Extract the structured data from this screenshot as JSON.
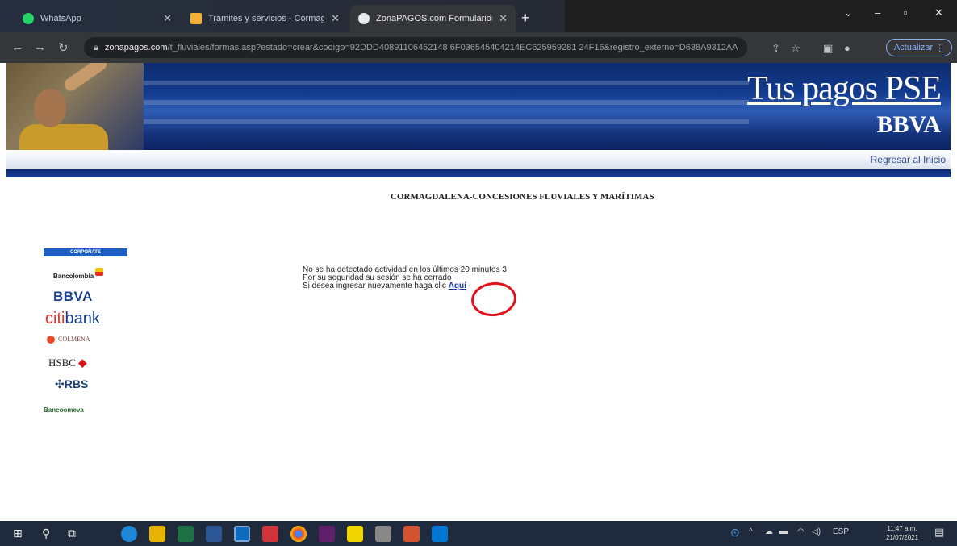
{
  "browser": {
    "tabs": [
      {
        "title": "WhatsApp",
        "active": false,
        "favicon_color": "#25d366"
      },
      {
        "title": "Trámites y servicios - Cormagdal...",
        "active": false,
        "favicon_color": "#f2b134"
      },
      {
        "title": "ZonaPAGOS.com Formularios",
        "active": true,
        "favicon_color": "#e8eaed"
      }
    ],
    "url_domain": "zonapagos.com",
    "url_path": "/t_fluviales/formas.asp?estado=crear&codigo=92DDD40891106452148 6F036545404214EC625959281 24F16&registro_externo=D638A9312AA...",
    "update_button": "Actualizar"
  },
  "site": {
    "brand_title": "Tus pagos PSE",
    "brand_bank": "BBVA",
    "back_link": "Regresar al Inicio",
    "page_title": "CORMAGDALENA-CONCESIONES FLUVIALES Y MARÍTIMAS"
  },
  "banks": {
    "corporate": "CORPORATE",
    "bancolombia": "Bancolombia",
    "bbva": "BBVA",
    "citi_a": "citi",
    "citi_b": "bank",
    "colmena": "COLMENA",
    "hsbc": "HSBC",
    "rbs": "RBS",
    "bancoomeva": "Bancoomeva"
  },
  "message": {
    "line1": "No se ha detectado actividad en los últimos 20 minutos 3",
    "line2": "Por su seguridad su sesión se ha cerrado",
    "line3": "Si desea ingresar nuevamente haga clic",
    "link": "Aquí"
  },
  "taskbar": {
    "lang": "ESP",
    "time": "11:47 a.m.",
    "date": "21/07/2021"
  },
  "colors": {
    "banner_blue": "#123b8f",
    "annotation_red": "#e3111b",
    "link_blue": "#1a3aa0"
  }
}
